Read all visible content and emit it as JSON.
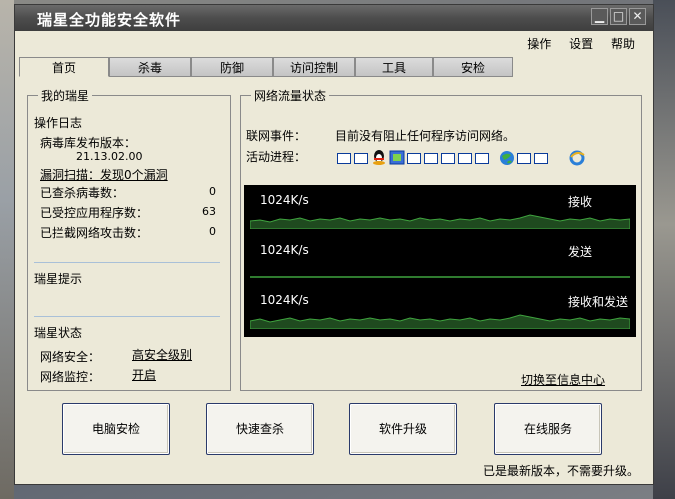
{
  "window": {
    "title": "瑞星全功能安全软件"
  },
  "menu": {
    "items": [
      "操作",
      "设置",
      "帮助"
    ]
  },
  "tabs": [
    "首页",
    "杀毒",
    "防御",
    "访问控制",
    "工具",
    "安检"
  ],
  "my_rising": {
    "group_title": "我的瑞星",
    "log_title": "操作日志",
    "virus_db_label": "病毒库发布版本：",
    "virus_db_version": "21.13.02.00",
    "vuln_scan": "漏洞扫描：发现0个漏洞",
    "stats": [
      {
        "label": "已查杀病毒数：",
        "value": "0"
      },
      {
        "label": "已受控应用程序数：",
        "value": "63"
      },
      {
        "label": "已拦截网络攻击数：",
        "value": "0"
      }
    ],
    "tips_title": "瑞星提示",
    "status_title": "瑞星状态",
    "net_security_label": "网络安全：",
    "net_security_value": "高安全级别",
    "net_monitor_label": "网络监控：",
    "net_monitor_value": "开启"
  },
  "network": {
    "group_title": "网络流量状态",
    "event_label": "联网事件：",
    "event_value": "目前没有阻止任何程序访问网络。",
    "process_label": "活动进程：",
    "traces": [
      {
        "scale": "1024K/s",
        "name": "接收"
      },
      {
        "scale": "1024K/s",
        "name": "发送"
      },
      {
        "scale": "1024K/s",
        "name": "接收和发送"
      }
    ],
    "switch_link": "切换至信息中心"
  },
  "buttons": [
    "电脑安检",
    "快速查杀",
    "软件升级",
    "在线服务"
  ],
  "status_bar": "已是最新版本，不需要升级。",
  "colors": {
    "trace": "#3fa43f",
    "trace_bg": "#000000",
    "link_sep": "#a9c0d8"
  }
}
